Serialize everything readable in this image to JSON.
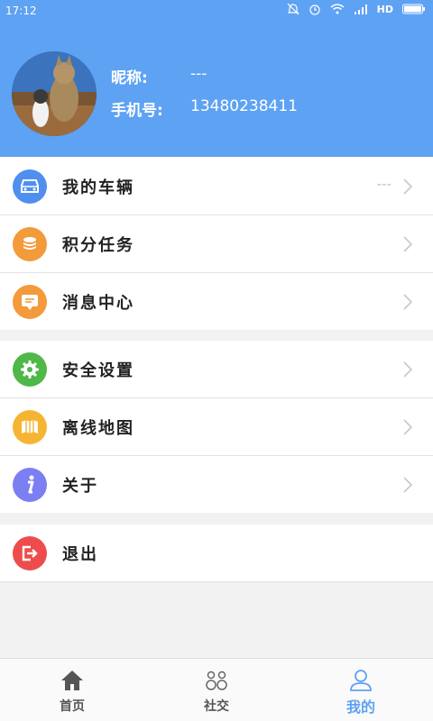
{
  "status_bar": {
    "time": "17:12",
    "network": "HD"
  },
  "profile": {
    "nickname_label": "昵称:",
    "nickname_value": "---",
    "phone_label": "手机号:",
    "phone_value": "13480238411"
  },
  "menu": {
    "groups": [
      [
        {
          "label": "我的车辆",
          "value": "---",
          "icon": "car-icon",
          "color": "#4f8ff0"
        },
        {
          "label": "积分任务",
          "icon": "coins-icon",
          "color": "#f39a3b"
        },
        {
          "label": "消息中心",
          "icon": "message-icon",
          "color": "#f39a3b"
        }
      ],
      [
        {
          "label": "安全设置",
          "icon": "gear-icon",
          "color": "#4fb848"
        },
        {
          "label": "离线地图",
          "icon": "map-icon",
          "color": "#f5b533"
        },
        {
          "label": "关于",
          "icon": "info-icon",
          "color": "#7b7ff2"
        }
      ],
      [
        {
          "label": "退出",
          "icon": "logout-icon",
          "color": "#ee4c4c"
        }
      ]
    ]
  },
  "bottom_nav": {
    "items": [
      {
        "label": "首页",
        "icon": "home-icon"
      },
      {
        "label": "社交",
        "icon": "social-icon"
      },
      {
        "label": "我的",
        "icon": "person-icon",
        "active": true
      }
    ],
    "active_color": "#5ea2f3"
  },
  "colors": {
    "header_bg": "#5ea2f3",
    "page_bg": "#f2f2f2"
  }
}
